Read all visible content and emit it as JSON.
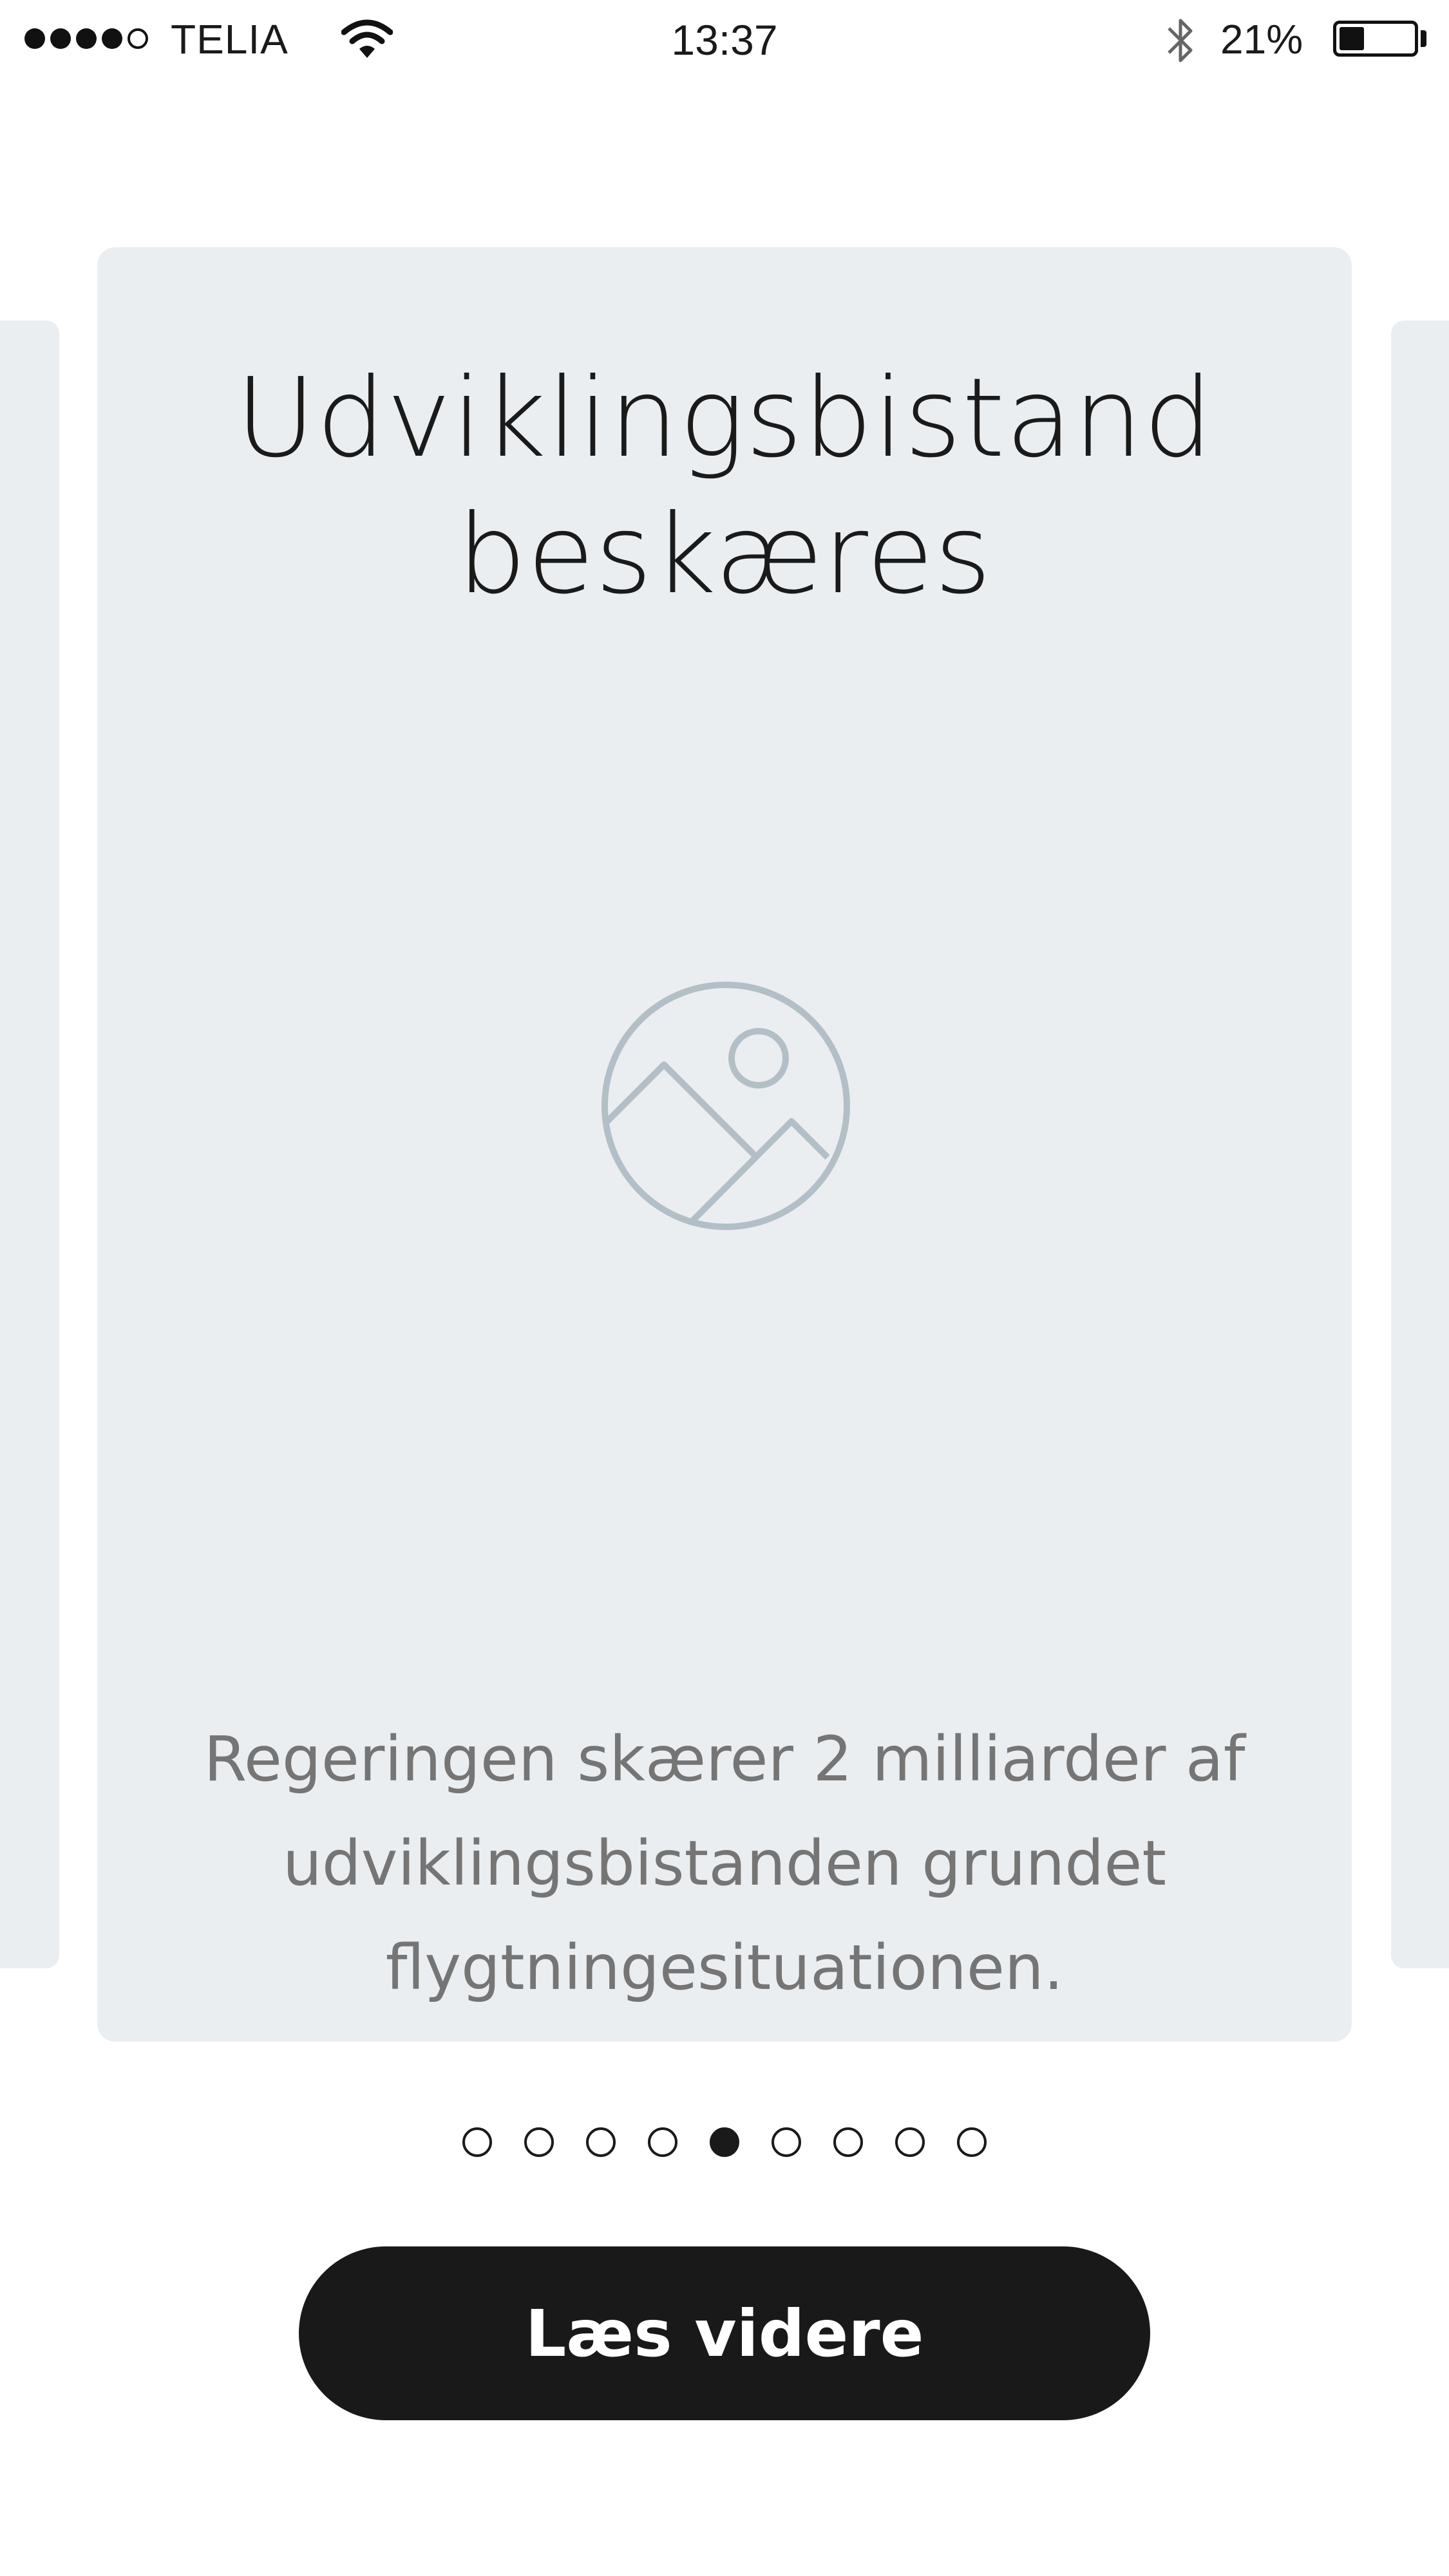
{
  "status_bar": {
    "carrier": "TELIA",
    "time": "13:37",
    "battery_percent": "21%",
    "battery_level": 0.21,
    "signal_bars_filled": 4,
    "signal_bars_total": 5,
    "icons": [
      "wifi-icon",
      "bluetooth-icon",
      "battery-icon"
    ]
  },
  "carousel": {
    "card": {
      "title": "Udviklingsbistand beskæres",
      "image_icon": "image-placeholder-icon",
      "description": "Regeringen skærer 2 milliarder af udviklingsbistanden grundet flygtningesituationen."
    },
    "page_count": 9,
    "active_page_index": 4
  },
  "action": {
    "read_more_label": "Læs videre"
  },
  "colors": {
    "card_background": "#ebeef1",
    "button_background": "#191919",
    "button_text": "#ffffff",
    "description_text": "#757575",
    "icon_stroke": "#b3bfc6"
  }
}
